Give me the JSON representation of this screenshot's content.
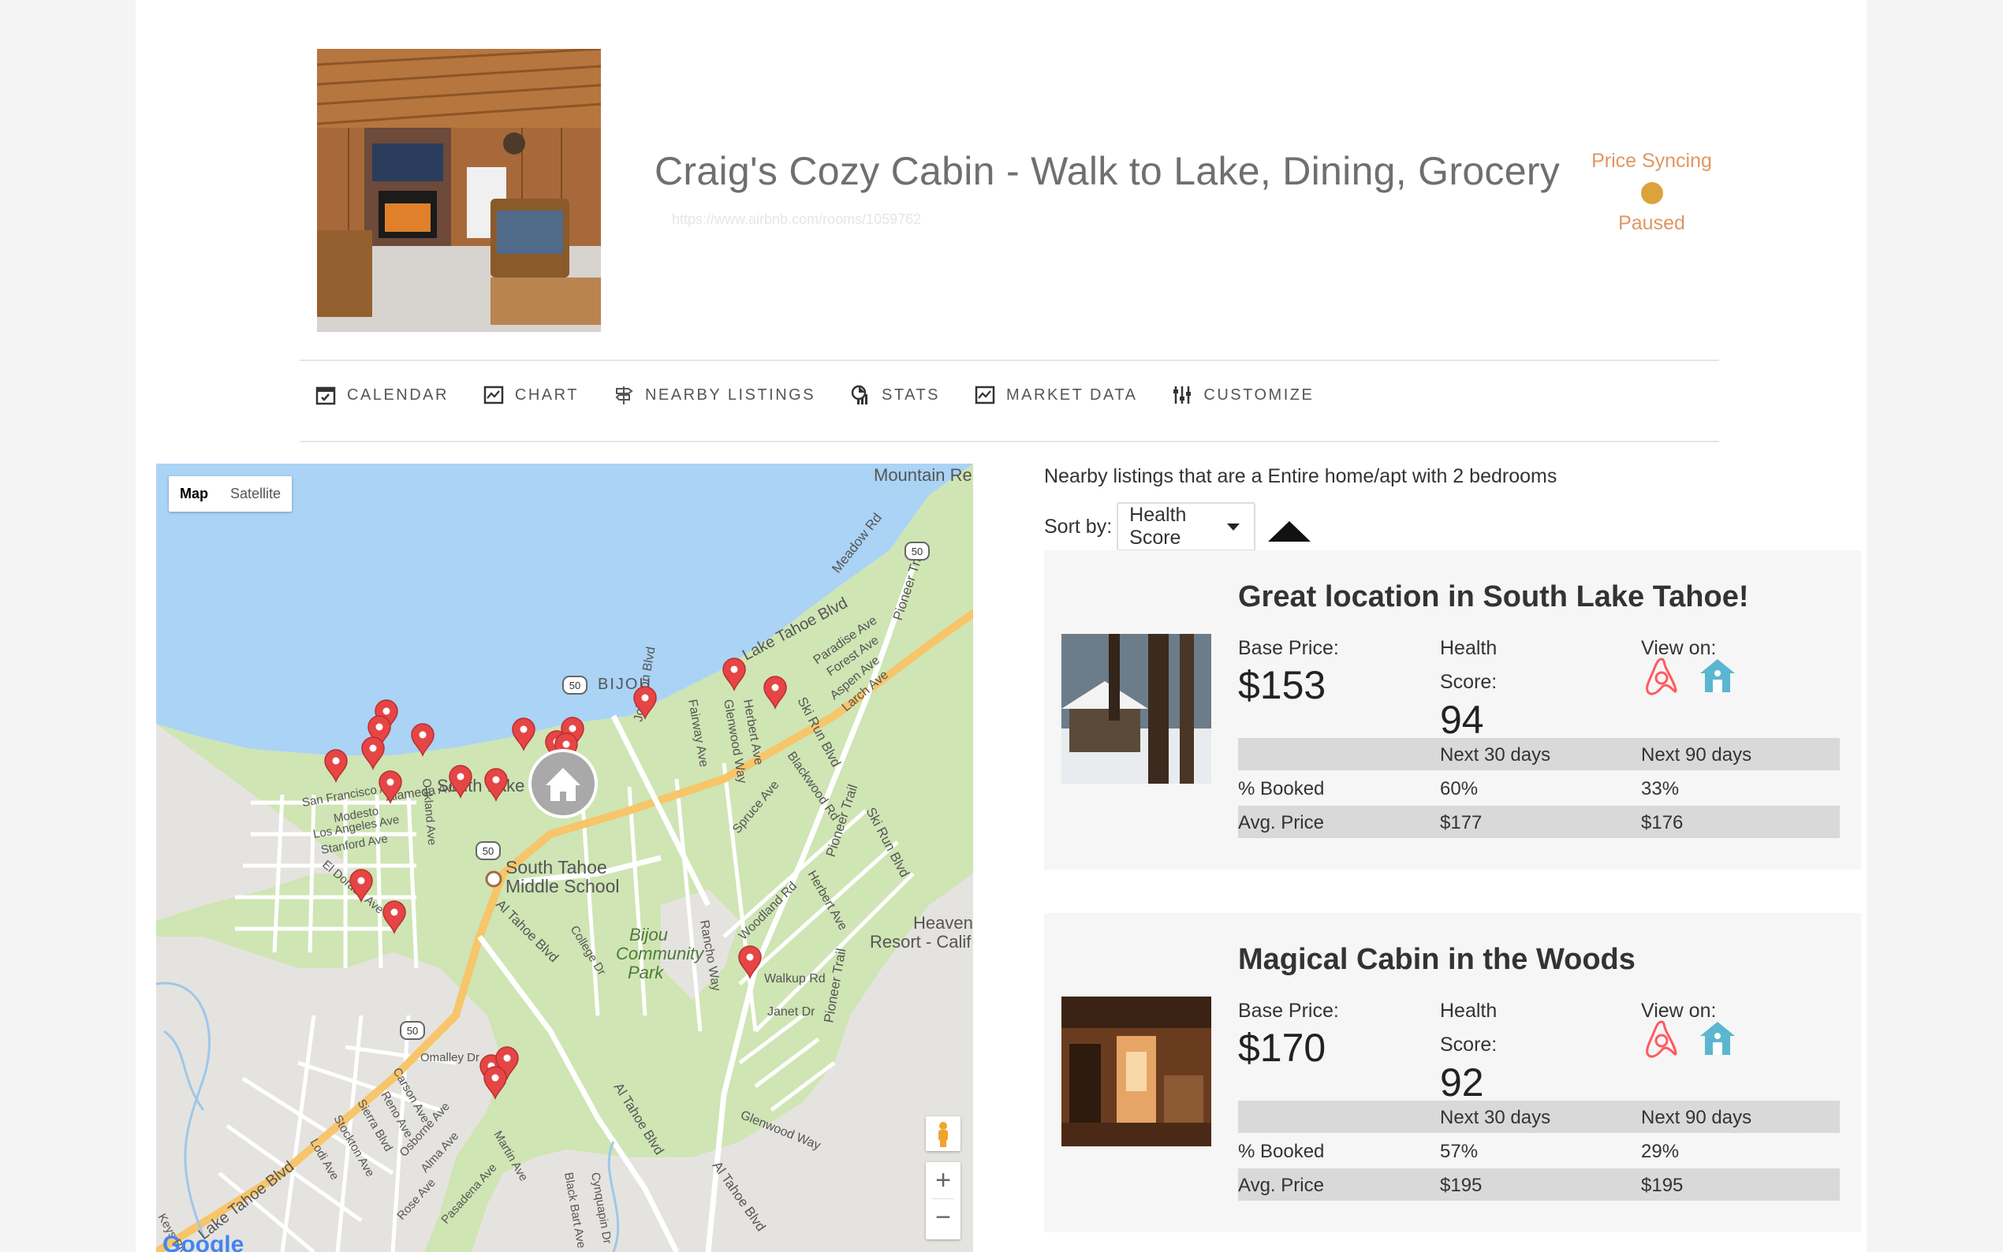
{
  "listing": {
    "title": "Craig's Cozy Cabin - Walk to Lake, Dining, Grocery",
    "url": "https://www.airbnb.com/rooms/1059762"
  },
  "sync_status": {
    "line1": "Price Syncing",
    "line2": "Paused",
    "color": "#e19660",
    "dot_color": "#dca23c"
  },
  "tabs": [
    {
      "label": "CALENDAR",
      "icon": "calendar-icon"
    },
    {
      "label": "CHART",
      "icon": "chart-icon"
    },
    {
      "label": "NEARBY LISTINGS",
      "icon": "signpost-icon"
    },
    {
      "label": "STATS",
      "icon": "stats-icon"
    },
    {
      "label": "MARKET DATA",
      "icon": "market-chart-icon"
    },
    {
      "label": "CUSTOMIZE",
      "icon": "sliders-icon"
    }
  ],
  "map": {
    "type_buttons": {
      "map": "Map",
      "satellite": "Satellite"
    },
    "labels": {
      "mountain": "Mountain Re",
      "heavenly": "Heaven",
      "resort": "Resort - Calif",
      "school1": "South Tahoe",
      "school2": "Middle School",
      "park1": "Bijou",
      "park2": "Community",
      "park3": "Park",
      "bijou": "BIJOU",
      "lake_tahoe_blvd": "Lake Tahoe Blvd",
      "lake_tahoe_blvd2": "Lake Tahoe Blvd",
      "al_tahoe_blvd": "Al Tahoe Blvd",
      "al_tahoe_blvd2": "Al Tahoe Blvd",
      "al_tahoe_blvd3": "Al Tahoe Blvd",
      "pioneer_trail": "Pioneer Trail",
      "pioneer_trail2": "Pioneer Trail",
      "pioneer_trail3": "Pioneer Trail",
      "ski_run": "Ski Run Blvd",
      "ski_run2": "Ski Run Blvd",
      "meadow": "Meadow Rd",
      "paradise": "Paradise Ave",
      "forest": "Forest Ave",
      "aspen": "Aspen Ave",
      "larch": "Larch Ave",
      "glenwood": "Glenwood Way",
      "glenwood2": "Glenwood Way",
      "herbert": "Herbert Ave",
      "herbert2": "Herbert Ave",
      "fairway": "Fairway Ave",
      "blackwood": "Blackwood Rd",
      "spruce": "Spruce Ave",
      "woodland": "Woodland Rd",
      "rancho": "Rancho Way",
      "walkup": "Walkup Rd",
      "janet": "Janet Dr",
      "johnson": "Johnson Blvd",
      "alameda": "Alameda Ave",
      "sanfrancisco": "San Francisco Ave",
      "modesto": "Modesto",
      "losangeles": "Los Angeles Ave",
      "stanford": "Stanford Ave",
      "oakland": "Oakland Ave",
      "eldorado": "El Dorado Ave",
      "college": "College Dr",
      "omalley": "Omalley Dr",
      "carson": "Carson Ave",
      "reno": "Reno Ave",
      "sierra": "Sierra Blvd",
      "stockton": "Stockton Ave",
      "lodi": "Lodi Ave",
      "osborne": "Osborne Ave",
      "alma": "Alma Ave",
      "rose": "Rose Ave",
      "pasadena": "Pasadena Ave",
      "martin": "Martin Ave",
      "blackbart": "Black Bart Ave",
      "cynquapin": "Cynquapin Dr",
      "southlake": "South Lake",
      "keys": "Keys Blvd",
      "shield50a": "50",
      "shield50b": "50",
      "shield50c": "50",
      "shield50d": "50",
      "google": "Google",
      "zoom_in": "+",
      "zoom_out": "−"
    }
  },
  "nearby": {
    "intro": "Nearby listings that are a Entire home/apt with 2 bedrooms",
    "sort_label": "Sort by:",
    "sort_value": "Health Score"
  },
  "cards": [
    {
      "title": "Great location in South Lake Tahoe!",
      "base_price_label": "Base Price:",
      "base_price": "$153",
      "health_label1": "Health",
      "health_label2": "Score:",
      "health_score": "94",
      "view_label": "View on:",
      "col30": "Next 30 days",
      "col90": "Next 90 days",
      "booked_label": "% Booked",
      "booked30": "60%",
      "booked90": "33%",
      "avg_label": "Avg. Price",
      "avg30": "$177",
      "avg90": "$176"
    },
    {
      "title": "Magical Cabin in the Woods",
      "base_price_label": "Base Price:",
      "base_price": "$170",
      "health_label1": "Health",
      "health_label2": "Score:",
      "health_score": "92",
      "view_label": "View on:",
      "col30": "Next 30 days",
      "col90": "Next 90 days",
      "booked_label": "% Booked",
      "booked30": "57%",
      "booked90": "29%",
      "avg_label": "Avg. Price",
      "avg30": "$195",
      "avg90": "$195"
    }
  ],
  "colors": {
    "airbnb": "#ff5a5f",
    "homeaway": "#5bb6d0",
    "pin": "#e64545",
    "water": "#aad3f5",
    "park": "#cfe5b4"
  }
}
